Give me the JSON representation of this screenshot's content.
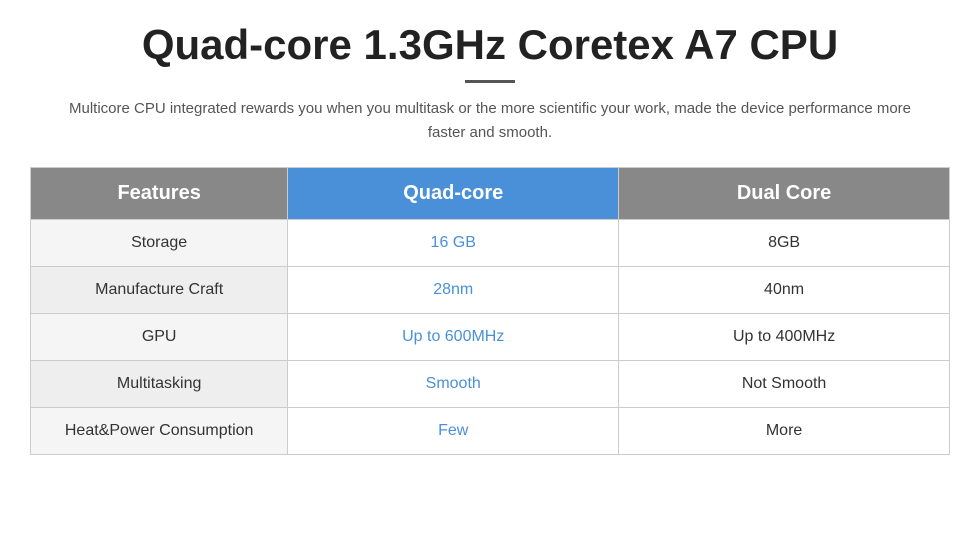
{
  "title": "Quad-core 1.3GHz Coretex A7 CPU",
  "subtitle": "Multicore CPU integrated rewards you when you multitask or the more scientific your work, made the device performance more faster and smooth.",
  "table": {
    "headers": {
      "features": "Features",
      "quad": "Quad-core",
      "dual": "Dual Core"
    },
    "rows": [
      {
        "feature": "Storage",
        "quad_value": "16 GB",
        "dual_value": "8GB"
      },
      {
        "feature": "Manufacture Craft",
        "quad_value": "28nm",
        "dual_value": "40nm"
      },
      {
        "feature": "GPU",
        "quad_value": "Up to 600MHz",
        "dual_value": "Up to 400MHz"
      },
      {
        "feature": "Multitasking",
        "quad_value": "Smooth",
        "dual_value": "Not Smooth"
      },
      {
        "feature": "Heat&Power Consumption",
        "quad_value": "Few",
        "dual_value": "More"
      }
    ]
  }
}
